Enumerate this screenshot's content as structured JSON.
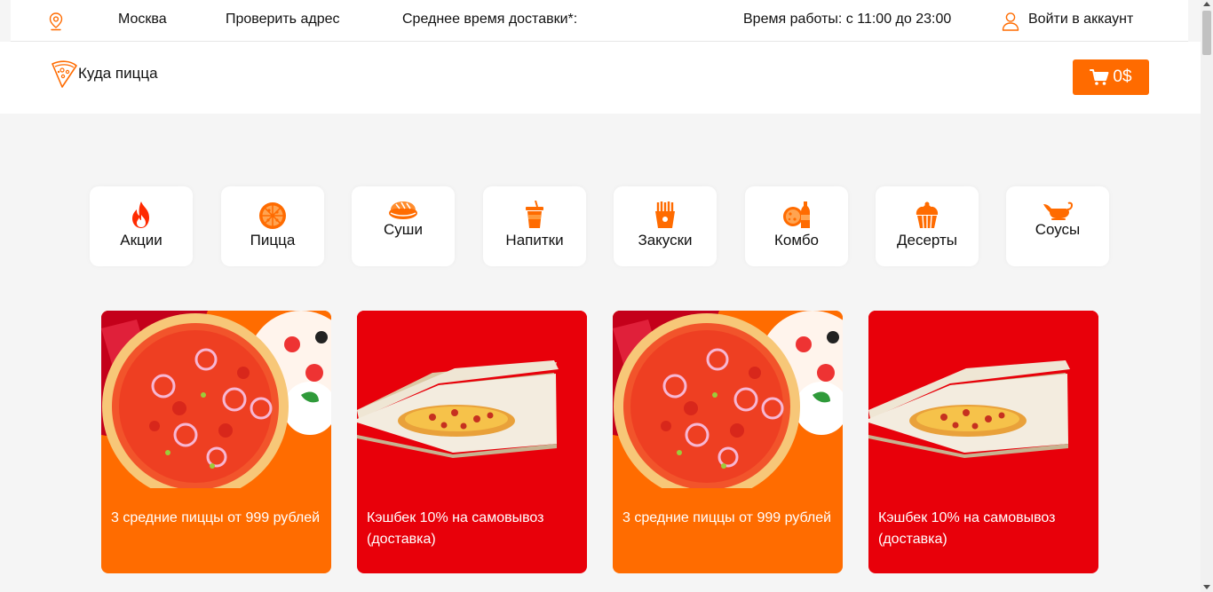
{
  "topbar": {
    "city": "Москва",
    "check_address": "Проверить адрес",
    "delivery_time": "Среднее время доставки*:",
    "working_hours": "Время работы: с 11:00 до 23:00",
    "login": "Войти в аккаунт"
  },
  "header": {
    "logo_text": "Куда пицца",
    "cart_amount": "0$"
  },
  "categories": [
    {
      "label": "Акции",
      "icon": "fire-icon"
    },
    {
      "label": "Пицца",
      "icon": "pizza-icon"
    },
    {
      "label": "Суши",
      "icon": "sushi-icon"
    },
    {
      "label": "Напитки",
      "icon": "drink-icon"
    },
    {
      "label": "Закуски",
      "icon": "fries-icon"
    },
    {
      "label": "Комбо",
      "icon": "combo-icon"
    },
    {
      "label": "Десерты",
      "icon": "cupcake-icon"
    },
    {
      "label": "Соусы",
      "icon": "sauce-icon"
    }
  ],
  "promos": [
    {
      "text": "3 средние пиццы от 999 рублей",
      "color": "#ff6c00"
    },
    {
      "text": "Кэшбек 10% на самовывоз (доставка)",
      "color": "#e8000a"
    },
    {
      "text": "3 средние пиццы от 999 рублей",
      "color": "#ff6c00"
    },
    {
      "text": "Кэшбек 10% на самовывоз (доставка)",
      "color": "#e8000a"
    }
  ],
  "colors": {
    "accent": "#ff6b00",
    "promo_orange": "#ff6c00",
    "promo_red": "#e8000a"
  }
}
